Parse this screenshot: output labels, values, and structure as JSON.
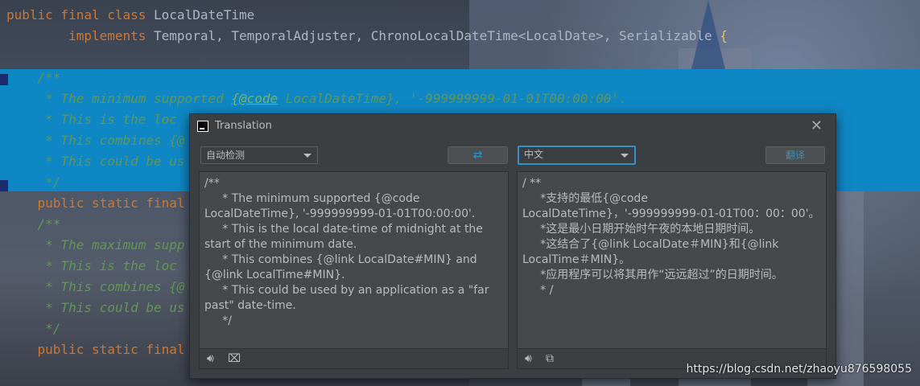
{
  "editor": {
    "lines": [
      {
        "parts": [
          {
            "c": "kw",
            "t": "public final class "
          },
          {
            "c": "",
            "t": "LocalDateTime"
          }
        ]
      },
      {
        "parts": [
          {
            "c": "",
            "t": "        "
          },
          {
            "c": "kw",
            "t": "implements "
          },
          {
            "c": "",
            "t": "Temporal, TemporalAdjuster, ChronoLocalDateTime<LocalDate>, Serializable "
          },
          {
            "c": "br",
            "t": "{"
          }
        ]
      },
      {
        "parts": []
      },
      {
        "parts": [
          {
            "c": "cm",
            "t": "    /**"
          }
        ]
      },
      {
        "parts": [
          {
            "c": "cm",
            "t": "     * The minimum supported "
          },
          {
            "c": "tg",
            "t": "{@code"
          },
          {
            "c": "cm",
            "t": " LocalDateTime}, '-999999999-01-01T00:00:00'."
          }
        ]
      },
      {
        "parts": [
          {
            "c": "cm",
            "t": "     * This is the loc"
          }
        ]
      },
      {
        "parts": [
          {
            "c": "cm",
            "t": "     * This combines {@"
          }
        ]
      },
      {
        "parts": [
          {
            "c": "cm",
            "t": "     * This could be us"
          }
        ]
      },
      {
        "parts": [
          {
            "c": "cm",
            "t": "     */"
          }
        ]
      },
      {
        "parts": [
          {
            "c": "",
            "t": "    "
          },
          {
            "c": "kw",
            "t": "public static final"
          }
        ]
      },
      {
        "parts": [
          {
            "c": "cm",
            "t": "    /**"
          }
        ]
      },
      {
        "parts": [
          {
            "c": "cm",
            "t": "     * The maximum supp"
          }
        ]
      },
      {
        "parts": [
          {
            "c": "cm",
            "t": "     * This is the loc"
          }
        ]
      },
      {
        "parts": [
          {
            "c": "cm",
            "t": "     * This combines {@"
          }
        ]
      },
      {
        "parts": [
          {
            "c": "cm",
            "t": "     * This could be us"
          }
        ]
      },
      {
        "parts": [
          {
            "c": "cm",
            "t": "     */"
          }
        ]
      },
      {
        "parts": [
          {
            "c": "",
            "t": "    "
          },
          {
            "c": "kw",
            "t": "public static final"
          }
        ]
      }
    ]
  },
  "dialog": {
    "title": "Translation",
    "source_language": "自动检测",
    "target_language": "中文",
    "swap_icon": "⇄",
    "translate_label": "翻译",
    "source_text": "/**\n     * The minimum supported {@code LocalDateTime}, '-999999999-01-01T00:00:00'.\n     * This is the local date-time of midnight at the start of the minimum date.\n     * This combines {@link LocalDate#MIN} and {@link LocalTime#MIN}.\n     * This could be used by an application as a \"far past\" date-time.\n     */",
    "target_text": "/ **\n     *支持的最低{@code LocalDateTime}，'-999999999-01-01T00：00：00'。\n     *这是最小日期开始时午夜的本地日期时间。\n     *这结合了{@link LocalDate＃MIN}和{@link LocalTime＃MIN}。\n     *应用程序可以将其用作“远远超过”的日期时间。\n     * /"
  },
  "watermark": "https://blog.csdn.net/zhaoyu876598055"
}
